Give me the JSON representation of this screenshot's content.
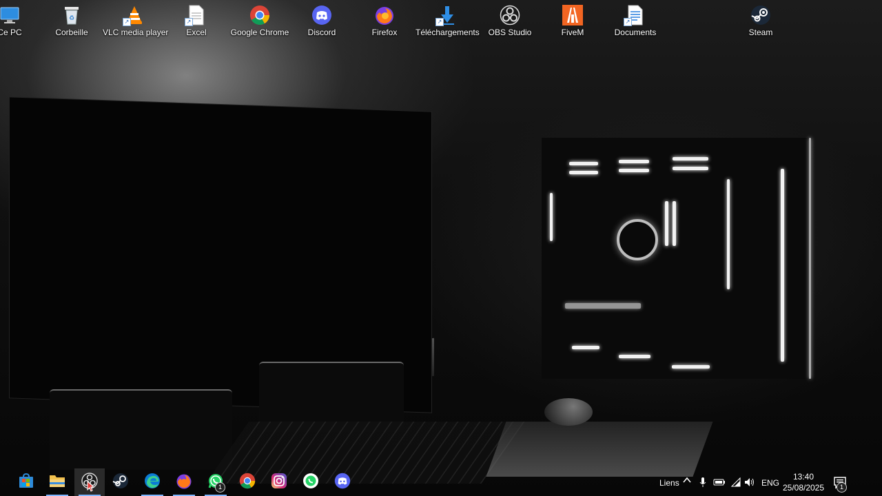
{
  "desktop": {
    "icons": [
      {
        "label": "Ce PC",
        "icon": "computer-icon"
      },
      {
        "label": "Corbeille",
        "icon": "recycle-bin-icon"
      },
      {
        "label": "VLC media player",
        "icon": "vlc-icon"
      },
      {
        "label": "Excel",
        "icon": "excel-file-icon"
      },
      {
        "label": "Google Chrome",
        "icon": "chrome-icon"
      },
      {
        "label": "Discord",
        "icon": "discord-icon"
      },
      {
        "label": "Firefox",
        "icon": "firefox-icon"
      },
      {
        "label": "Téléchargements",
        "icon": "downloads-icon"
      },
      {
        "label": "OBS Studio",
        "icon": "obs-icon"
      },
      {
        "label": "FiveM",
        "icon": "fivem-icon"
      },
      {
        "label": "Documents",
        "icon": "documents-icon"
      },
      {
        "label": "Steam",
        "icon": "steam-icon"
      }
    ]
  },
  "taskbar": {
    "pinned": [
      {
        "name": "microsoft-store",
        "icon": "store-icon"
      },
      {
        "name": "file-explorer",
        "icon": "folder-icon"
      },
      {
        "name": "obs-studio",
        "icon": "obs-icon",
        "active": true
      },
      {
        "name": "steam",
        "icon": "steam-icon"
      },
      {
        "name": "edge",
        "icon": "edge-icon"
      },
      {
        "name": "firefox",
        "icon": "firefox-icon"
      },
      {
        "name": "whatsapp",
        "icon": "whatsapp-icon",
        "badge": "1"
      },
      {
        "name": "chrome",
        "icon": "chrome-icon"
      },
      {
        "name": "instagram",
        "icon": "instagram-icon"
      },
      {
        "name": "whatsapp-web",
        "icon": "whatsapp-icon"
      },
      {
        "name": "discord",
        "icon": "discord-icon"
      }
    ],
    "tray": {
      "links_label": "Liens",
      "language": "ENG",
      "time": "13:40",
      "date": "25/08/2025",
      "notification_count": "1"
    }
  },
  "colors": {
    "chrome_red": "#db4437",
    "chrome_yellow": "#f4b400",
    "chrome_green": "#0f9d58",
    "chrome_blue": "#4285f4",
    "discord": "#5865f2",
    "steam": "#1b2838",
    "whatsapp": "#25d366",
    "excel": "#1d6f42"
  }
}
